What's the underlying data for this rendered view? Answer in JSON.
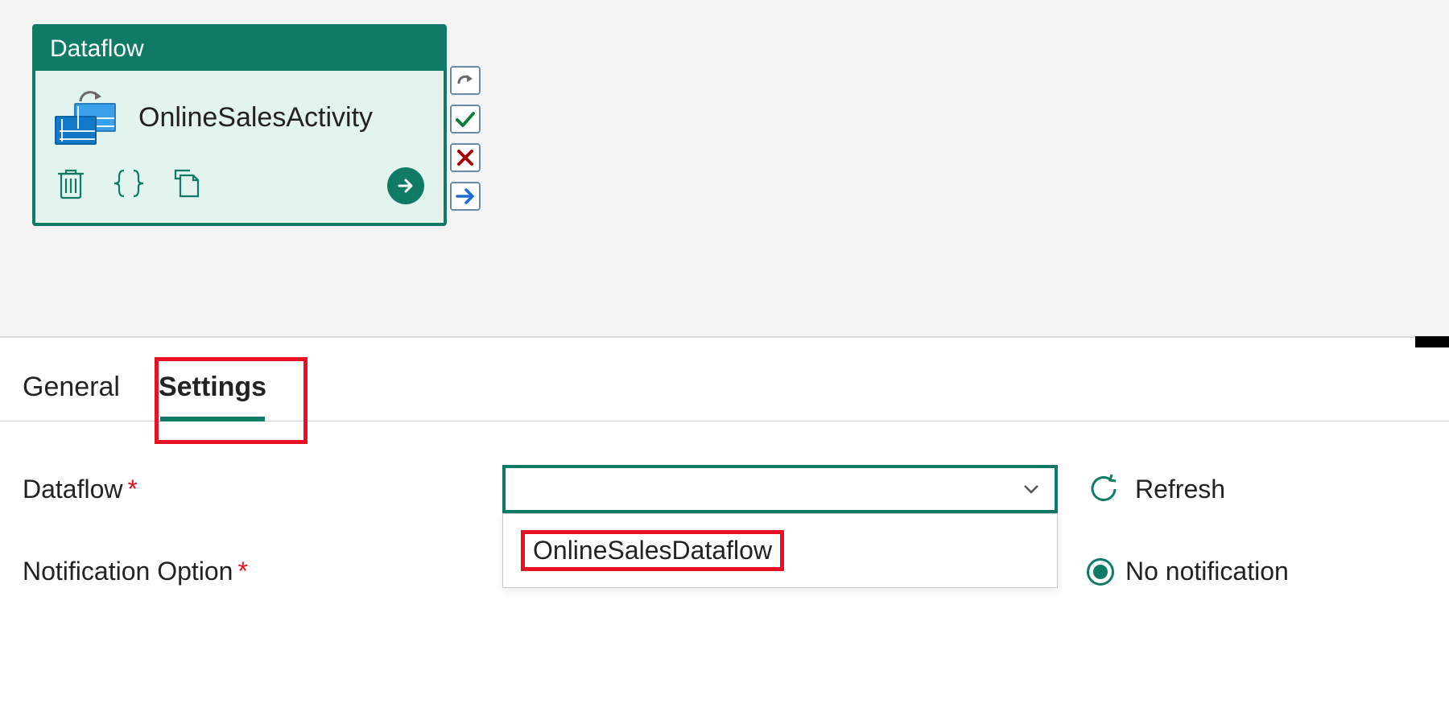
{
  "node": {
    "type_label": "Dataflow",
    "title": "OnlineSalesActivity",
    "side_actions": {
      "redo": "redo-icon",
      "success": "check-icon",
      "fail": "x-icon",
      "skip": "arrow-right-icon"
    }
  },
  "tabs": {
    "general": "General",
    "settings": "Settings",
    "active": "settings"
  },
  "form": {
    "dataflow_label": "Dataflow",
    "dataflow_value": "",
    "dataflow_options": [
      "OnlineSalesDataflow"
    ],
    "refresh_label": "Refresh",
    "notification_label": "Notification Option",
    "notification_selected": "No notification"
  }
}
